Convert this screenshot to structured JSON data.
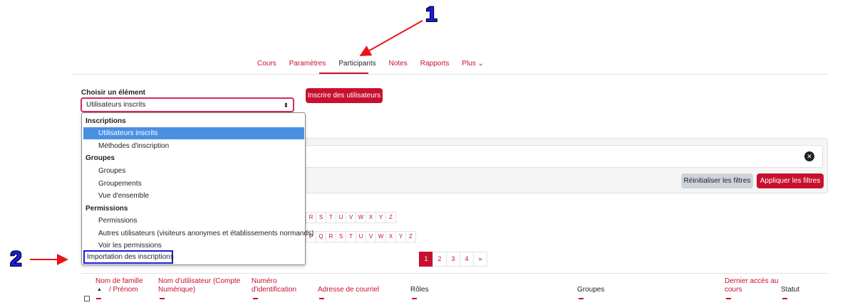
{
  "nav": {
    "items": [
      "Cours",
      "Paramètres",
      "Participants",
      "Notes",
      "Rapports",
      "Plus ⌄"
    ],
    "active_index": 2
  },
  "annotations": {
    "n1": "1",
    "n2": "2"
  },
  "select": {
    "label": "Choisir un élément",
    "value": "Utilisateurs inscrits",
    "caret": "⬍"
  },
  "enrol_button": "Inscrire des utilisateurs",
  "dropdown": {
    "groups": [
      {
        "label": "Inscriptions",
        "options": [
          "Utilisateurs inscrits",
          "Méthodes d'inscription"
        ]
      },
      {
        "label": "Groupes",
        "options": [
          "Groupes",
          "Groupements",
          "Vue d'ensemble"
        ]
      },
      {
        "label": "Permissions",
        "options": [
          "Permissions",
          "Autres utilisateurs (visiteurs anonymes et établissements normands)",
          "Voir les permissions"
        ]
      }
    ],
    "highlighted_option": "Importation des inscriptions",
    "selected": "Utilisateurs inscrits"
  },
  "filters": {
    "close_icon": "✕",
    "reset_label": "Réinitialiser les filtres",
    "apply_label": "Appliquer les filtres"
  },
  "letters_row1": [
    "R",
    "S",
    "T",
    "U",
    "V",
    "W",
    "X",
    "Y",
    "Z"
  ],
  "letters_row2": [
    "P",
    "Q",
    "R",
    "S",
    "T",
    "U",
    "V",
    "W",
    "X",
    "Y",
    "Z"
  ],
  "pagination": [
    "1",
    "2",
    "3",
    "4",
    "»"
  ],
  "table": {
    "headers": {
      "lastname": "Nom de famille",
      "firstname": "/ Prénom",
      "sort_icon": "▲",
      "username_1": "Nom d'utilisateur (Compte",
      "username_2": "Numérique)",
      "idnumber_1": "Numéro",
      "idnumber_2": "d'identification",
      "email": "Adresse de courriel",
      "roles": "Rôles",
      "groups": "Groupes",
      "lastaccess_1": "Dernier accès au",
      "lastaccess_2": "cours",
      "status": "Statut"
    }
  },
  "colors": {
    "accent": "#c8102e",
    "select_highlight": "#4a90e2",
    "annotation_blue": "#1a1aff",
    "arrow_red": "#e8141a"
  }
}
